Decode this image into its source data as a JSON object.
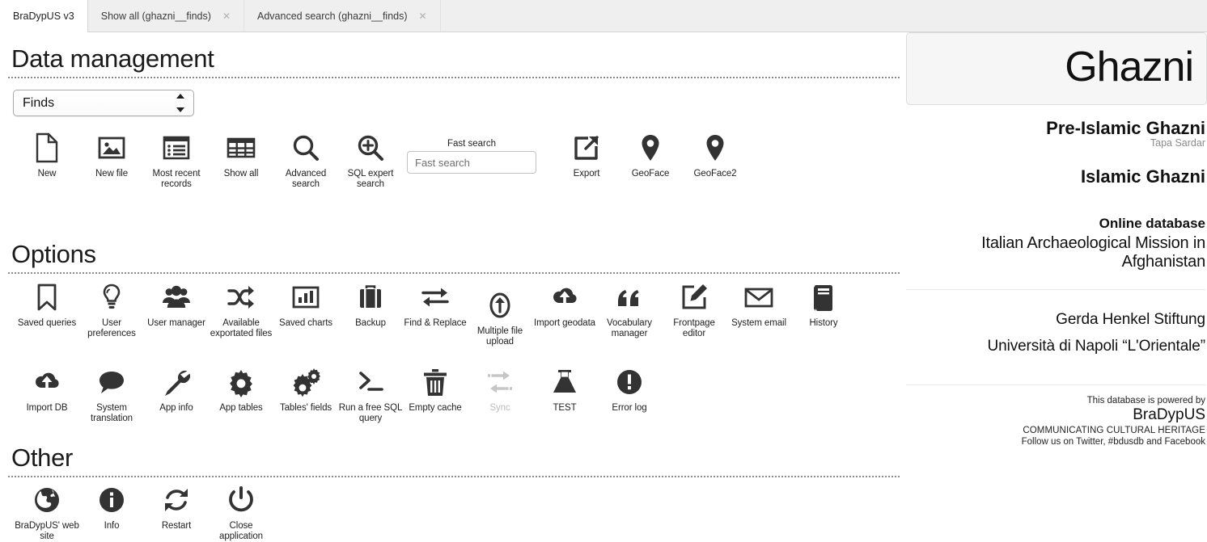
{
  "tabs": [
    {
      "label": "BraDypUS v3",
      "closable": false,
      "active": true
    },
    {
      "label": "Show all (ghazni__finds)",
      "closable": true,
      "active": false
    },
    {
      "label": "Advanced search (ghazni__finds)",
      "closable": true,
      "active": false
    }
  ],
  "close_glyph": "✕",
  "sections": {
    "data_management": {
      "title": "Data management"
    },
    "options": {
      "title": "Options"
    },
    "other": {
      "title": "Other"
    }
  },
  "table_select": {
    "value": "Finds"
  },
  "fast_search": {
    "label": "Fast search",
    "placeholder": "Fast search",
    "value": ""
  },
  "data_management_tools": [
    {
      "icon": "new-document-icon",
      "label": "New"
    },
    {
      "icon": "new-file-image-icon",
      "label": "New file"
    },
    {
      "icon": "recent-records-list-icon",
      "label": "Most recent records"
    },
    {
      "icon": "grid-table-icon",
      "label": "Show all"
    },
    {
      "icon": "magnifier-icon",
      "label": "Advanced search"
    },
    {
      "icon": "magnifier-plus-icon",
      "label": "SQL expert search"
    },
    {
      "icon": "export-arrow-icon",
      "label": "Export"
    },
    {
      "icon": "map-pin-icon",
      "label": "GeoFace"
    },
    {
      "icon": "map-pin-icon",
      "label": "GeoFace2"
    }
  ],
  "options_tools_row1": [
    {
      "icon": "bookmark-icon",
      "label": "Saved queries"
    },
    {
      "icon": "lightbulb-icon",
      "label": "User preferences"
    },
    {
      "icon": "users-group-icon",
      "label": "User manager"
    },
    {
      "icon": "shuffle-arrows-icon",
      "label": "Available exportated files"
    },
    {
      "icon": "bar-chart-icon",
      "label": "Saved charts"
    },
    {
      "icon": "briefcase-icon",
      "label": "Backup"
    },
    {
      "icon": "exchange-arrows-icon",
      "label": "Find & Replace"
    },
    {
      "icon": "upload-circle-icon",
      "label": "Multiple file upload"
    },
    {
      "icon": "cloud-upload-icon",
      "label": "Import geodata"
    },
    {
      "icon": "quote-marks-icon",
      "label": "Vocabulary manager"
    },
    {
      "icon": "edit-pencil-square-icon",
      "label": "Frontpage editor"
    },
    {
      "icon": "envelope-icon",
      "label": "System email"
    },
    {
      "icon": "book-icon",
      "label": "History"
    }
  ],
  "options_tools_row2": [
    {
      "icon": "cloud-upload-icon",
      "label": "Import DB"
    },
    {
      "icon": "speech-bubble-icon",
      "label": "System translation"
    },
    {
      "icon": "wrench-icon",
      "label": "App info"
    },
    {
      "icon": "gear-icon",
      "label": "App tables"
    },
    {
      "icon": "gears-icon",
      "label": "Tables' fields"
    },
    {
      "icon": "terminal-prompt-icon",
      "label": "Run a free SQL query"
    },
    {
      "icon": "trash-can-icon",
      "label": "Empty cache"
    },
    {
      "icon": "sync-arrows-icon",
      "label": "Sync",
      "disabled": true
    },
    {
      "icon": "flask-icon",
      "label": "TEST"
    },
    {
      "icon": "error-exclamation-icon",
      "label": "Error log"
    }
  ],
  "other_tools": [
    {
      "icon": "globe-icon",
      "label": "BraDypUS' web site"
    },
    {
      "icon": "info-circle-icon",
      "label": "Info"
    },
    {
      "icon": "restart-refresh-icon",
      "label": "Restart"
    },
    {
      "icon": "power-icon",
      "label": "Close application"
    }
  ],
  "right_panel": {
    "brand": "Ghazni",
    "heading_1": "Pre-Islamic Ghazni",
    "subtitle_1": "Tapa Sardar",
    "heading_2": "Islamic Ghazni",
    "online_database": "Online database",
    "mission": "Italian Archaeological Mission in Afghanistan",
    "org_1": "Gerda Henkel Stiftung",
    "org_2": "Università di Napoli “L'Orientale”",
    "powered_by": "This database is powered by",
    "powered_name": "BraDypUS",
    "tagline": "COMMUNICATING CULTURAL HERITAGE",
    "follow": "Follow us on Twitter, #bdusdb and Facebook"
  }
}
